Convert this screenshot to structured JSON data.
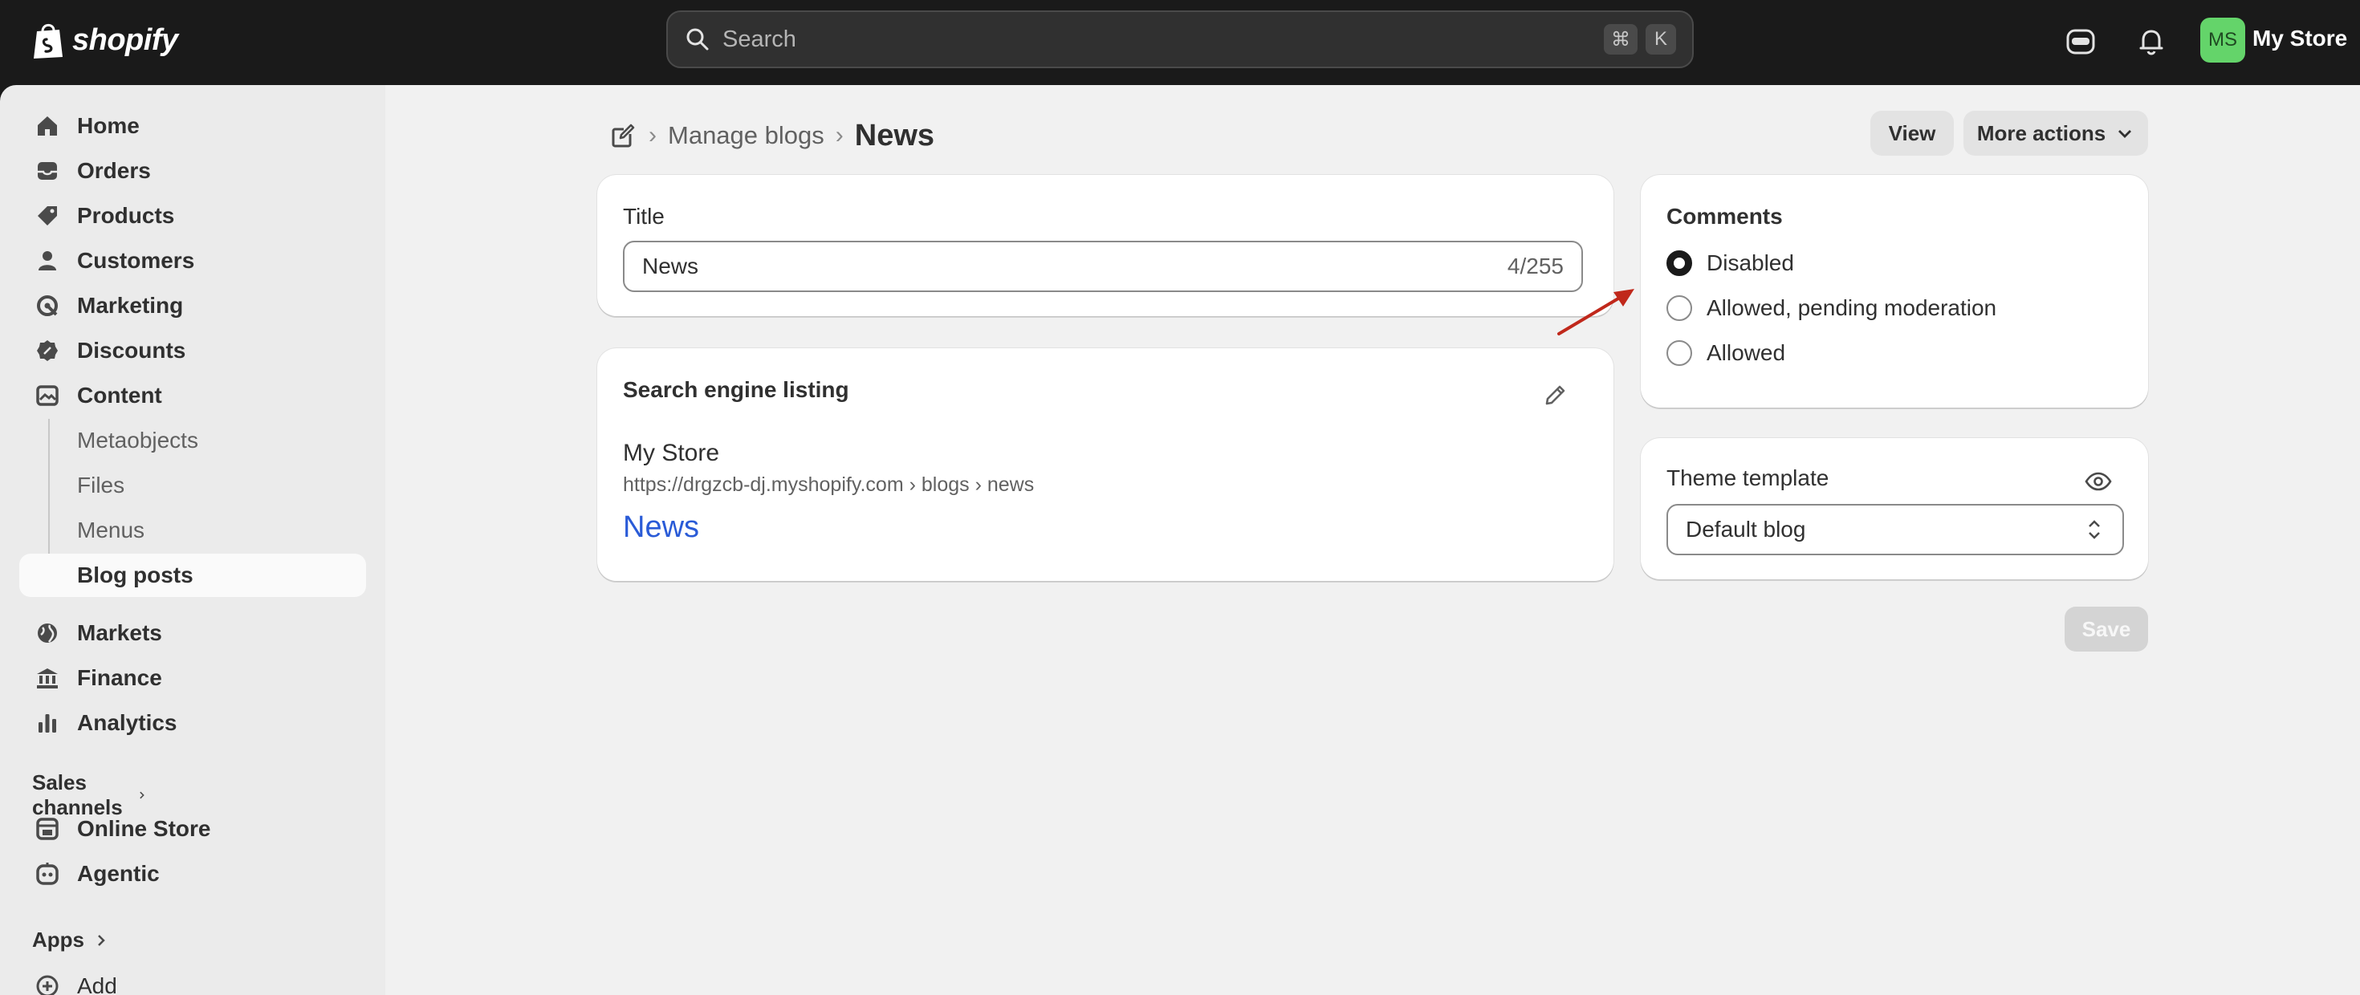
{
  "brand": {
    "name": "shopify"
  },
  "topbar": {
    "search_placeholder": "Search",
    "shortcut_cmd": "⌘",
    "shortcut_key": "K",
    "avatar_initials": "MS",
    "store_name": "My Store"
  },
  "sidebar": {
    "items": [
      {
        "label": "Home",
        "icon": "home-icon"
      },
      {
        "label": "Orders",
        "icon": "inbox-icon"
      },
      {
        "label": "Products",
        "icon": "tag-icon"
      },
      {
        "label": "Customers",
        "icon": "person-icon"
      },
      {
        "label": "Marketing",
        "icon": "target-icon"
      },
      {
        "label": "Discounts",
        "icon": "discount-icon"
      },
      {
        "label": "Content",
        "icon": "image-content-icon"
      }
    ],
    "content_sub": [
      "Metaobjects",
      "Files",
      "Menus",
      "Blog posts"
    ],
    "items2": [
      {
        "label": "Markets",
        "icon": "globe-icon"
      },
      {
        "label": "Finance",
        "icon": "bank-icon"
      },
      {
        "label": "Analytics",
        "icon": "bar-chart-icon"
      }
    ],
    "sales_channels_label": "Sales channels",
    "channels": [
      {
        "label": "Online Store",
        "icon": "store-icon"
      },
      {
        "label": "Agentic",
        "icon": "agentic-icon"
      }
    ],
    "apps_label": "Apps",
    "add_label": "Add"
  },
  "header": {
    "breadcrumb_link": "Manage blogs",
    "title": "News",
    "view_label": "View",
    "more_actions_label": "More actions"
  },
  "title_card": {
    "label": "Title",
    "value": "News",
    "count": "4/255"
  },
  "seo_card": {
    "heading": "Search engine listing",
    "store": "My Store",
    "url": "https://drgzcb-dj.myshopify.com › blogs › news",
    "title": "News"
  },
  "comments_card": {
    "heading": "Comments",
    "options": [
      "Disabled",
      "Allowed, pending moderation",
      "Allowed"
    ],
    "selected": "Disabled"
  },
  "theme_card": {
    "label": "Theme template",
    "value": "Default blog"
  },
  "save_label": "Save",
  "colors": {
    "topbar_bg": "#1a1a1a",
    "sidebar_bg": "#ebebeb",
    "main_bg": "#f1f1f1",
    "link_blue": "#2a5bd7",
    "avatar_green": "#64d46a",
    "annotation_arrow": "#c0281b"
  }
}
